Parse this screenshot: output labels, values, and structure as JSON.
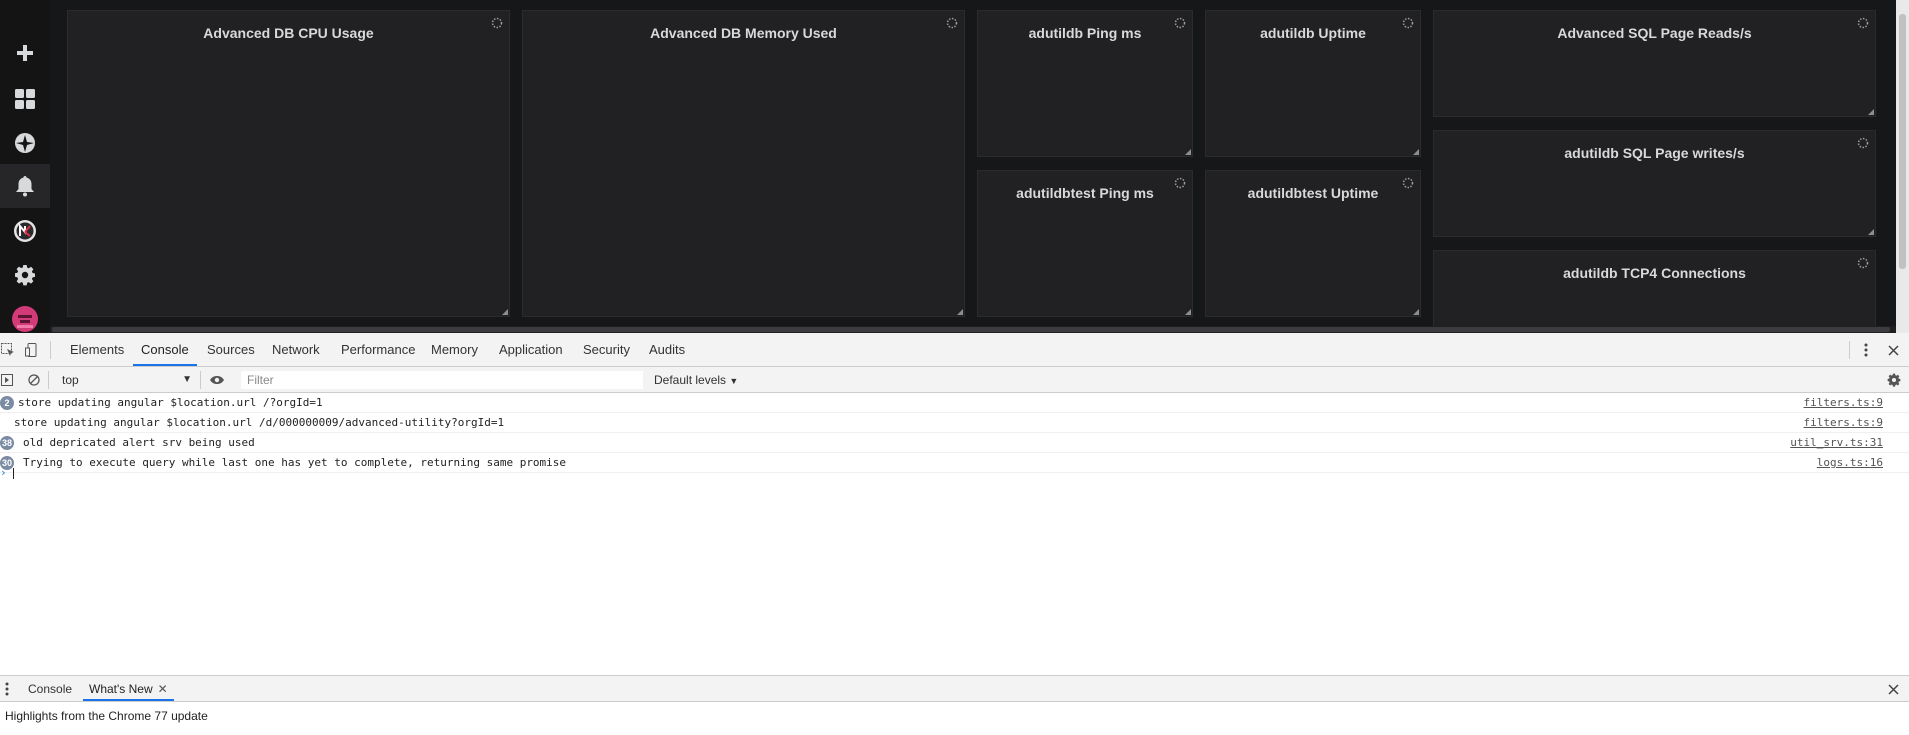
{
  "dashboard": {
    "panels": [
      {
        "title": "Advanced DB CPU Usage"
      },
      {
        "title": "Advanced DB Memory Used"
      },
      {
        "title": "adutildb Ping ms"
      },
      {
        "title": "adutildb Uptime"
      },
      {
        "title": "Advanced SQL Page Reads/s"
      },
      {
        "title": "adutildbtest Ping ms"
      },
      {
        "title": "adutildbtest Uptime"
      },
      {
        "title": "adutildb SQL Page writes/s"
      },
      {
        "title": "adutildb TCP4 Connections"
      }
    ],
    "sidebar_icons": [
      "plus-icon",
      "dashboards-icon",
      "explore-compass-icon",
      "alerting-bell-icon",
      "plugin-logo-icon",
      "gear-icon",
      "user-avatar-icon"
    ]
  },
  "devtools": {
    "tabs": [
      "Elements",
      "Console",
      "Sources",
      "Network",
      "Performance",
      "Memory",
      "Application",
      "Security",
      "Audits"
    ],
    "active_tab": "Console",
    "toolbar": {
      "context": "top",
      "filter_placeholder": "Filter",
      "levels": "Default levels"
    },
    "logs": [
      {
        "count": "2",
        "message": "store updating angular $location.url /?orgId=1",
        "source": "filters.ts:9"
      },
      {
        "count": "",
        "message": "store updating angular $location.url /d/000000009/advanced-utility?orgId=1",
        "source": "filters.ts:9"
      },
      {
        "count": "38",
        "message": "old depricated alert srv being used",
        "source": "util_srv.ts:31"
      },
      {
        "count": "30",
        "message": "Trying to execute query while last one has yet to complete, returning same promise",
        "source": "logs.ts:16"
      }
    ],
    "drawer": {
      "tabs": [
        "Console",
        "What's New"
      ],
      "active_tab": "What's New",
      "content": "Highlights from the Chrome 77 update"
    }
  }
}
